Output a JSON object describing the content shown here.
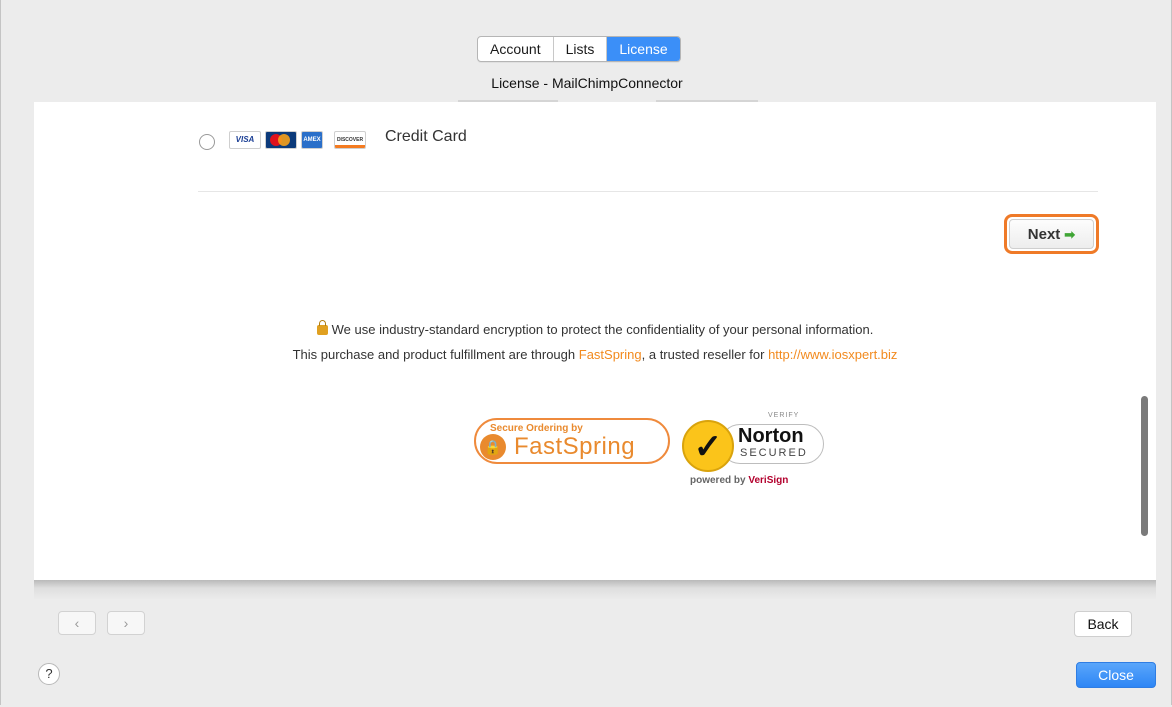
{
  "tabs": [
    {
      "label": "Account",
      "active": false
    },
    {
      "label": "Lists",
      "active": false
    },
    {
      "label": "License",
      "active": true
    }
  ],
  "pane_title": "License - MailChimpConnector",
  "payment": {
    "option_label": "Credit Card",
    "selected": false,
    "cards": [
      "VISA",
      "MasterCard",
      "AMEX",
      "DISCOVER"
    ]
  },
  "next_button": {
    "label": "Next",
    "icon": "arrow-right-icon"
  },
  "info": {
    "line1": "We use industry-standard encryption to protect the confidentiality of your personal information.",
    "line2_prefix": "This purchase and product fulfillment are through ",
    "line2_link1": "FastSpring",
    "line2_middle": ", a trusted reseller for ",
    "line2_link2": "http://www.iosxpert.biz"
  },
  "badges": {
    "fastspring_top": "Secure Ordering by",
    "fastspring_name": "FastSpring",
    "norton_verify": "VERIFY",
    "norton_name": "Norton",
    "norton_secured": "SECURED",
    "norton_powered_prefix": "powered by ",
    "norton_powered_brand": "VeriSign"
  },
  "nav": {
    "prev": "‹",
    "next": "›"
  },
  "back_button": "Back",
  "close_button": "Close",
  "help_button": "?",
  "colors": {
    "accent": "#3b8ff8",
    "highlight": "#ef7a28",
    "link": "#f28a1e"
  }
}
